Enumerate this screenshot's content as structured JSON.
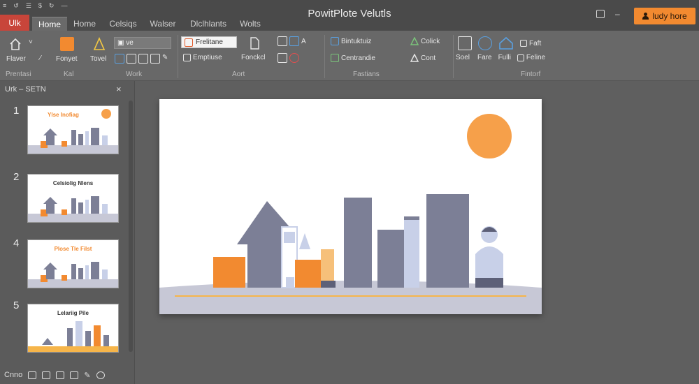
{
  "app": {
    "title": "PowitPlote Velutls"
  },
  "quick_access": [
    "≡",
    "↺",
    "☰",
    "$",
    "↻",
    "—"
  ],
  "tabs": [
    {
      "label": "Ulk",
      "active": false,
      "style": "file"
    },
    {
      "label": "Home",
      "active": true
    },
    {
      "label": "Home",
      "active": false
    },
    {
      "label": "Celsiqs",
      "active": false
    },
    {
      "label": "Walser",
      "active": false
    },
    {
      "label": "Dlclhlants",
      "active": false
    },
    {
      "label": "Wolts",
      "active": false
    }
  ],
  "window_controls": {
    "restore": "□",
    "minimize": "–"
  },
  "help_button": {
    "label": "ludy hore",
    "color": "#f28a30"
  },
  "ribbon": {
    "clipboard": {
      "paste_label": "Flaver",
      "paste_arrow": "˅"
    },
    "font_group": {
      "format_label": "Fonyet",
      "tovel_label": "Tovel",
      "combo_value": "▣ ve"
    },
    "para_group": {
      "combo_value": "Frelitane",
      "emptiuse_label": "Emptiuse",
      "fonckcl_label": "Fonckcl"
    },
    "positions_group": {
      "bullets_label": "Bintuktuiz",
      "centrandie_label": "Centrandie"
    },
    "styles_group": {
      "colick_label": "Colick",
      "cont_label": "Cont"
    },
    "editing_group": {
      "soel_label": "Soel",
      "fare_label": "Fare",
      "fulli_label": "Fulli",
      "faft_label": "Faft",
      "feline_label": "Feline"
    },
    "group_labels": {
      "clipboard": "Prentasi",
      "font": "Kal",
      "word": "Work",
      "para": "Aort",
      "positions": "Fastians",
      "editing": "Fintorf"
    }
  },
  "thumbnail_pane": {
    "title": "Urk – SETN",
    "close": "×",
    "slides": [
      {
        "number": "1",
        "title": "Ylse Inofiag",
        "title_color": "#f28a30"
      },
      {
        "number": "2",
        "title": "Celsiolig Nlens",
        "title_color": "#333333"
      },
      {
        "number": "4",
        "title": "Plose Tle Filst",
        "title_color": "#f28a30"
      },
      {
        "number": "5",
        "title": "Lelariig Pile",
        "title_color": "#333333"
      }
    ]
  },
  "status_bar": {
    "label": "Cnno"
  },
  "colors": {
    "accent": "#f28a30",
    "shape_gray": "#7c7f96",
    "shape_light": "#c8d0e8",
    "ground": "#c7c8d6",
    "file_tab": "#c8453a"
  }
}
